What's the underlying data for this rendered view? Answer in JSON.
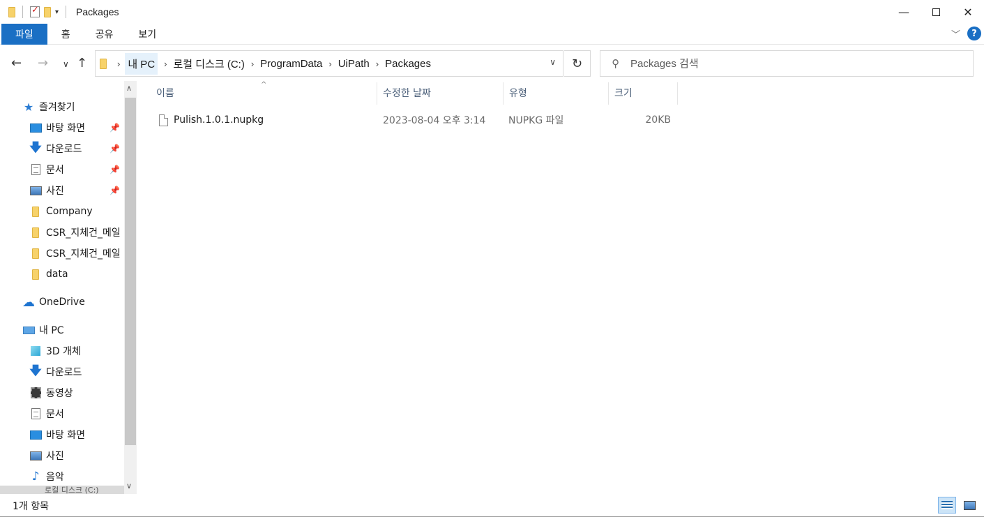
{
  "window": {
    "title": "Packages",
    "minimize_glyph": "—",
    "close_glyph": "✕"
  },
  "ribbon": {
    "tabs": [
      {
        "label": "파일",
        "active": true
      },
      {
        "label": "홈"
      },
      {
        "label": "공유"
      },
      {
        "label": "보기"
      }
    ],
    "help_label": "?",
    "accent_color": "#1a6fc4"
  },
  "address": {
    "crumbs": [
      "내 PC",
      "로컬 디스크 (C:)",
      "ProgramData",
      "UiPath",
      "Packages"
    ]
  },
  "search": {
    "placeholder": "Packages 검색"
  },
  "sidebar": {
    "quick_access": {
      "label": "즐겨찾기",
      "icon": "star-icon"
    },
    "quick_items": [
      {
        "label": "바탕 화면",
        "icon": "desktop-icon",
        "pinned": true
      },
      {
        "label": "다운로드",
        "icon": "download-icon",
        "pinned": true
      },
      {
        "label": "문서",
        "icon": "document-icon",
        "pinned": true
      },
      {
        "label": "사진",
        "icon": "pictures-icon",
        "pinned": true
      },
      {
        "label": "Company",
        "icon": "folder-icon"
      },
      {
        "label": "CSR_지체건_메일",
        "icon": "folder-icon"
      },
      {
        "label": "CSR_지체건_메일",
        "icon": "folder-icon"
      },
      {
        "label": "data",
        "icon": "folder-icon"
      }
    ],
    "onedrive": {
      "label": "OneDrive",
      "icon": "cloud-icon"
    },
    "this_pc": {
      "label": "내 PC",
      "icon": "pc-icon"
    },
    "pc_items": [
      {
        "label": "3D 개체",
        "icon": "3d-objects-icon"
      },
      {
        "label": "다운로드",
        "icon": "download-icon"
      },
      {
        "label": "동영상",
        "icon": "videos-icon"
      },
      {
        "label": "문서",
        "icon": "document-icon"
      },
      {
        "label": "바탕 화면",
        "icon": "desktop-icon"
      },
      {
        "label": "사진",
        "icon": "pictures-icon"
      },
      {
        "label": "음악",
        "icon": "music-icon"
      }
    ],
    "partial_item": "로컬 디스크 (C:)"
  },
  "columns": {
    "name": "이름",
    "modified": "수정한 날짜",
    "type": "유형",
    "size": "크기"
  },
  "files": [
    {
      "name": "Pulish.1.0.1.nupkg",
      "modified": "2023-08-04 오후 3:14",
      "type": "NUPKG 파일",
      "size": "20KB",
      "icon": "file-icon"
    }
  ],
  "status": {
    "item_count": "1개 항목"
  }
}
